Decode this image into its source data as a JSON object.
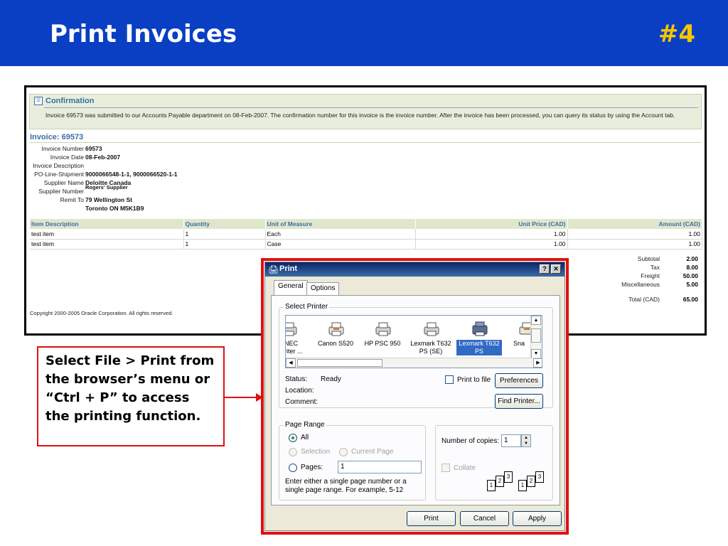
{
  "slide": {
    "title": "Print Invoices",
    "number": "#4",
    "callout": "Select File > Print from the browser’s menu or “Ctrl + P” to access the printing function."
  },
  "confirmation": {
    "title": "Confirmation",
    "message": "Invoice 69573 was submitted to our Accounts Payable department on 08-Feb-2007. The confirmation number for this invoice is the invoice number. After the invoice has been processed, you can query its status by using the Account tab."
  },
  "invoice": {
    "heading": "Invoice: 69573",
    "fields": [
      {
        "label": "Invoice Number",
        "value": "69573"
      },
      {
        "label": "Invoice Date",
        "value": "08-Feb-2007"
      },
      {
        "label": "Invoice Description",
        "value": ""
      },
      {
        "label": "PO-Line-Shipment",
        "value": "9000066548-1-1, 9000066520-1-1"
      },
      {
        "label": "Supplier Name",
        "value": "Deloitte Canada"
      },
      {
        "label": "Supplier Number",
        "value": ""
      },
      {
        "label": "Remit To",
        "value": "79 Wellington St"
      },
      {
        "label": "",
        "value": "Toronto ON M5K1B9"
      }
    ],
    "overlay_value": "Rogers' Supplier",
    "columns": [
      "Item Description",
      "Quantity",
      "Unit of Measure",
      "Unit Price (CAD)",
      "Amount (CAD)"
    ],
    "rows": [
      [
        "test item",
        "1",
        "Each",
        "1.00",
        "1.00"
      ],
      [
        "test item",
        "1",
        "Case",
        "1.00",
        "1.00"
      ]
    ],
    "totals": [
      {
        "label": "Subtotal",
        "value": "2.00"
      },
      {
        "label": "Tax",
        "value": "8.00"
      },
      {
        "label": "Freight",
        "value": "50.00"
      },
      {
        "label": "Miscellaneous",
        "value": "5.00"
      },
      {
        "label": "Total (CAD)",
        "value": "65.00"
      }
    ],
    "copyright": "Copyright 2000-2005 Oracle Corporation. All rights reserved."
  },
  "dialog": {
    "title": "Print",
    "help_btn": "?",
    "close_btn": "✕",
    "tabs": [
      "General",
      "Options"
    ],
    "select_printer_title": "Select Printer",
    "printers": [
      {
        "label": "NEC\nriter ...",
        "icon": "printer-icon"
      },
      {
        "label": "Canon S520",
        "icon": "printer-icon"
      },
      {
        "label": "HP PSC 950",
        "icon": "printer-icon"
      },
      {
        "label": "Lexmark T632\nPS (SE)",
        "icon": "printer-icon"
      },
      {
        "label": "Lexmark T632\nPS",
        "icon": "network-printer-icon"
      },
      {
        "label": "Sna",
        "icon": "printer-icon"
      }
    ],
    "status_label": "Status:",
    "status_value": "Ready",
    "location_label": "Location:",
    "comment_label": "Comment:",
    "print_to_file": "Print to file",
    "preferences": "Preferences",
    "find_printer": "Find Printer...",
    "page_range_title": "Page Range",
    "all_label": "All",
    "selection_label": "Selection",
    "current_page_label": "Current Page",
    "pages_label": "Pages:",
    "pages_value": "1",
    "page_range_hint": "Enter either a single page number or a single page range.  For example, 5-12",
    "copies_label": "Number of copies:",
    "copies_value": "1",
    "collate_label": "Collate",
    "collate_pages": [
      "1",
      "2",
      "3",
      "1",
      "2",
      "3"
    ],
    "print_btn": "Print",
    "cancel_btn": "Cancel",
    "apply_btn": "Apply"
  }
}
